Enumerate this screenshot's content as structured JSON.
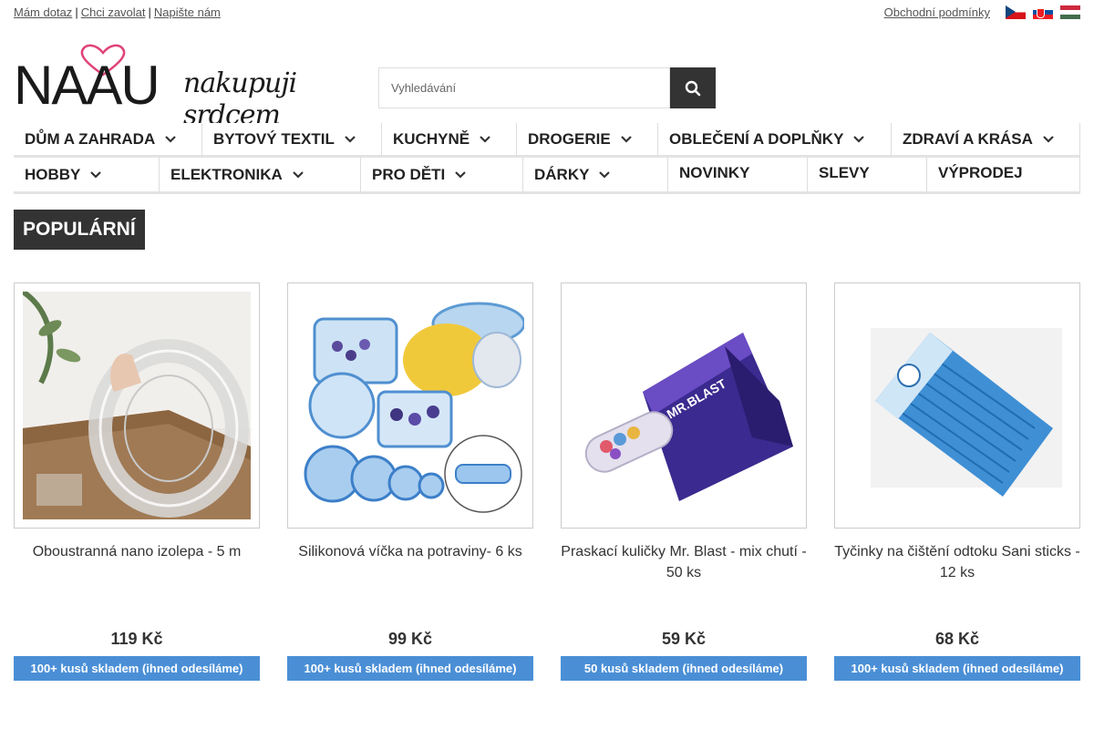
{
  "topbar": {
    "links": [
      "Mám dotaz",
      "Chci zavolat",
      "Napište nám"
    ],
    "terms": "Obchodní podmínky"
  },
  "logo": {
    "word": "NAAU",
    "slogan": "nakupuji srdcem"
  },
  "search": {
    "placeholder": "Vyhledávání"
  },
  "nav": {
    "row1": [
      "DŮM A ZAHRADA",
      "BYTOVÝ TEXTIL",
      "KUCHYNĚ",
      "DROGERIE",
      "OBLEČENÍ A DOPLŇKY",
      "ZDRAVÍ A KRÁSA"
    ],
    "row2": [
      "HOBBY",
      "ELEKTRONIKA",
      "PRO DĚTI",
      "DÁRKY",
      "NOVINKY",
      "SLEVY",
      "VÝPRODEJ"
    ]
  },
  "section": {
    "title": "POPULÁRNÍ"
  },
  "products": [
    {
      "name": "Oboustranná nano izolepa - 5 m",
      "price": "119 Kč",
      "stock": "100+ kusů skladem (ihned odesíláme)"
    },
    {
      "name": "Silikonová víčka na potraviny- 6 ks",
      "price": "99 Kč",
      "stock": "100+ kusů skladem (ihned odesíláme)"
    },
    {
      "name": "Praskací kuličky Mr. Blast - mix chutí - 50 ks",
      "price": "59 Kč",
      "stock": "50 kusů skladem (ihned odesíláme)"
    },
    {
      "name": "Tyčinky na čištění odtoku Sani sticks - 12 ks",
      "price": "68 Kč",
      "stock": "100+ kusů skladem (ihned odesíláme)"
    }
  ],
  "colors": {
    "accent": "#4a8fd6",
    "dark": "#333333",
    "logo_heart": "#e0427a"
  }
}
